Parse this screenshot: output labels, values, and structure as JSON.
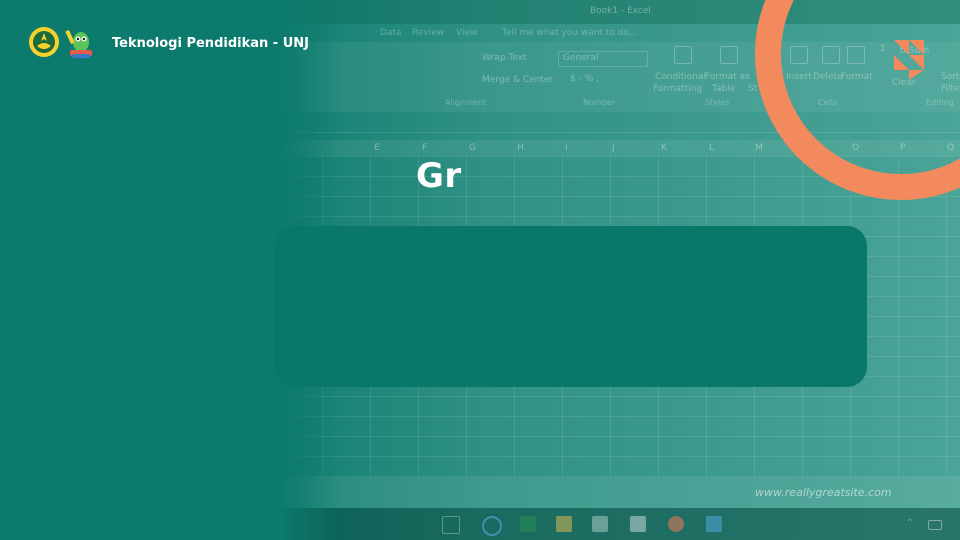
{
  "header": {
    "title": "Teknologi Pendidikan - UNJ",
    "logo_left": "unj-logo-icon",
    "logo_right": "mascot-icon"
  },
  "slide": {
    "heading": "Gr",
    "website": "www.reallygreatsite.com"
  },
  "background_excel": {
    "window_title": "Book1 - Excel",
    "menu": [
      "Data",
      "Review",
      "View",
      "Tell me what you want to do..."
    ],
    "ribbon": {
      "wrap_text": "Wrap Text",
      "merge_center": "Merge & Center",
      "number_format": "General",
      "conditional_formatting": [
        "Conditional",
        "Formatting"
      ],
      "format_as_table": [
        "Format as",
        "Table"
      ],
      "cell_styles_partial": "St",
      "insert": "Insert",
      "delete": "Delete",
      "format": "Format",
      "autosum_partial": "toSum",
      "clear": "Clear",
      "sort_filter": [
        "Sort",
        "Filter"
      ],
      "groups": [
        "Alignment",
        "Number",
        "Styles",
        "Cells",
        "Editing"
      ]
    },
    "columns": [
      "E",
      "F",
      "G",
      "H",
      "I",
      "J",
      "K",
      "L",
      "M",
      "O",
      "P",
      "Q"
    ]
  },
  "colors": {
    "background": "#0c7a6c",
    "card": "#0a7868",
    "accent_ring": "#f28a5e",
    "text": "#ffffff"
  }
}
